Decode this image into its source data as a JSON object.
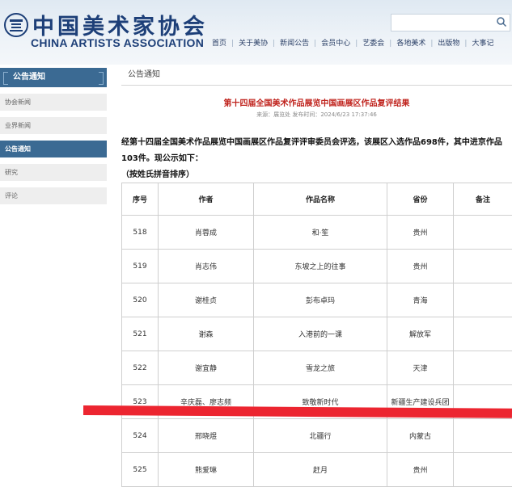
{
  "header": {
    "logo_cn": "中国美术家协会",
    "logo_en": "CHINA ARTISTS ASSOCIATION",
    "search": {
      "placeholder": "",
      "icon": "search-icon"
    },
    "nav": [
      "首页",
      "关于美协",
      "新闻公告",
      "会员中心",
      "艺委会",
      "各地美术",
      "出版物",
      "大事记"
    ]
  },
  "sidebar": {
    "header": "公告通知",
    "items": [
      {
        "label": "协会新闻",
        "active": false
      },
      {
        "label": "业界新闻",
        "active": false
      },
      {
        "label": "公告通知",
        "active": true
      },
      {
        "label": "研究",
        "active": false
      },
      {
        "label": "评论",
        "active": false
      }
    ]
  },
  "breadcrumb": "公告通知",
  "article": {
    "title": "第十四届全国美术作品展览中国画展区作品复评结果",
    "meta": "来源：展览处 发布时间：2024/6/23 17:37:46",
    "body": "经第十四届全国美术作品展览中国画展区作品复评评审委员会评选，该展区入选作品698件，其中进京作品103件。现公示如下：",
    "note": "（按姓氏拼音排序）"
  },
  "table": {
    "headers": [
      "序号",
      "作者",
      "作品名称",
      "省份",
      "备注"
    ],
    "rows": [
      [
        "518",
        "肖蓉成",
        "和·笙",
        "贵州",
        ""
      ],
      [
        "519",
        "肖志伟",
        "东坡之上的往事",
        "贵州",
        ""
      ],
      [
        "520",
        "谢桂贞",
        "彭布卓玛",
        "青海",
        ""
      ],
      [
        "521",
        "谢森",
        "入港前的一课",
        "解放军",
        ""
      ],
      [
        "522",
        "谢宜静",
        "雪龙之旅",
        "天津",
        ""
      ],
      [
        "523",
        "辛庆磊、廖志频",
        "致敬新时代",
        "新疆生产建设兵团",
        ""
      ],
      [
        "524",
        "邢晓煜",
        "北疆行",
        "内蒙古",
        ""
      ],
      [
        "525",
        "熊爱琳",
        "赶月",
        "贵州",
        ""
      ]
    ]
  },
  "colors": {
    "accent": "#3b6a93",
    "title_red": "#c0241e",
    "overlay_red": "#ec2530"
  }
}
